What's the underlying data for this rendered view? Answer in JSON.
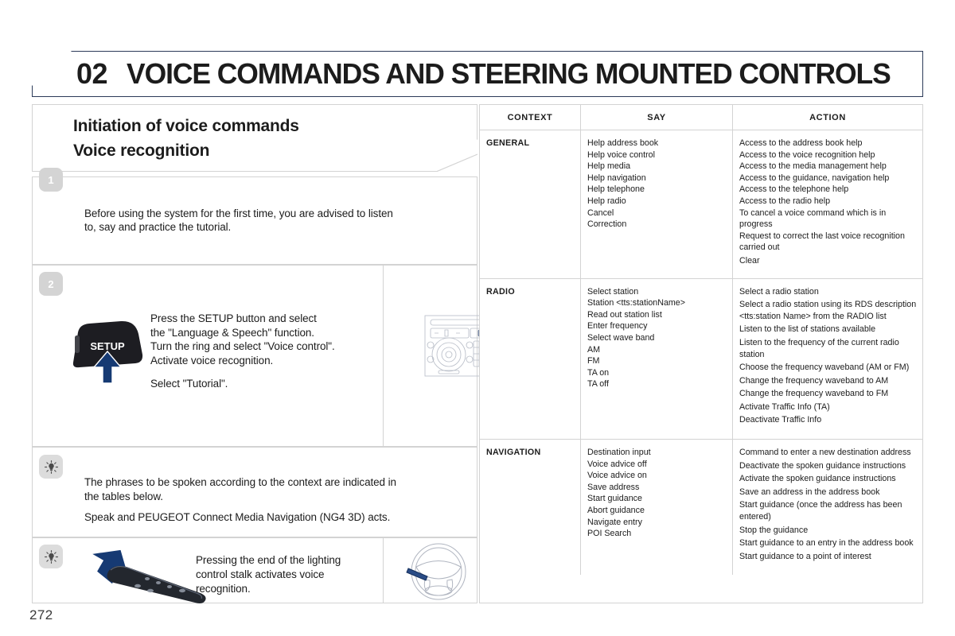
{
  "header": {
    "chapter_number": "02",
    "chapter_title": "VOICE COMMANDS AND STEERING MOUNTED CONTROLS"
  },
  "section_head": {
    "line1": "Initiation of voice commands",
    "line2": "Voice recognition",
    "icon": "speaking-head-icon"
  },
  "steps": [
    {
      "badge": "1",
      "badge_kind": "number",
      "text_lines": [
        "Before using the system for the first time, you are advised to listen",
        "to, say and practice the tutorial."
      ]
    },
    {
      "badge": "2",
      "badge_kind": "number",
      "button_label": "SETUP",
      "text_lines": [
        "Press the SETUP button and select",
        "the \"Language & Speech\" function.",
        "Turn the ring and select \"Voice control\".",
        "Activate voice recognition."
      ],
      "text_extra": "Select \"Tutorial\".",
      "illustration": "radio-head-unit-illustration"
    },
    {
      "badge": "bulb",
      "badge_kind": "bulb",
      "text_lines": [
        "The phrases to be spoken according to the context are indicated in",
        "the tables below."
      ],
      "text_extra": "Speak and PEUGEOT Connect Media Navigation (NG4 3D) acts."
    },
    {
      "badge": "bulb",
      "badge_kind": "bulb",
      "text_lines": [
        "Pressing the end of the lighting",
        "control stalk activates voice",
        "recognition."
      ],
      "illustration": "steering-wheel-illustration",
      "illustration_left": "lighting-control-stalk-illustration"
    }
  ],
  "table": {
    "columns": [
      "CONTEXT",
      "SAY",
      "ACTION"
    ],
    "rows": [
      {
        "context": "GENERAL",
        "say": [
          "Help address book",
          "Help voice control",
          "Help media",
          "Help navigation",
          "Help telephone",
          "Help radio",
          "Cancel",
          "Correction"
        ],
        "action": [
          "Access to the address book help",
          "Access to the voice recognition help",
          "Access to the media management help",
          "Access to the guidance, navigation help",
          "Access to the telephone help",
          "Access to the radio help",
          "To cancel a voice command which is in progress",
          "Request to correct the last voice recognition carried out",
          "Clear"
        ]
      },
      {
        "context": "RADIO",
        "say": [
          "Select station",
          "Station <tts:stationName>",
          "Read out station list",
          "Enter frequency",
          "Select wave band",
          "AM",
          "FM",
          "TA on",
          "TA off"
        ],
        "action": [
          "Select a radio station",
          "Select a radio station using its RDS description <tts:station Name> from the RADIO list",
          "Listen to the list of stations available",
          "Listen to the frequency of the current radio station",
          "Choose the frequency waveband (AM or FM)",
          "Change the frequency waveband to AM",
          "Change the frequency waveband to FM",
          "Activate Traffic Info (TA)",
          "Deactivate Traffic Info"
        ]
      },
      {
        "context": "NAVIGATION",
        "say": [
          "Destination input",
          "Voice advice off",
          "Voice advice on",
          "Save address",
          "Start guidance",
          "Abort guidance",
          "Navigate entry",
          "POI Search"
        ],
        "action": [
          "Command to enter a new destination address",
          "Deactivate the spoken guidance instructions",
          "Activate the spoken guidance instructions",
          "Save an address in the address book",
          "Start guidance (once the address has been entered)",
          "Stop the guidance",
          "Start guidance to an entry in the address book",
          "Start guidance to a point of interest"
        ]
      }
    ]
  },
  "footer": {
    "page_number": "272"
  },
  "colors": {
    "border_dark": "#2b3a58",
    "border_light": "#d3d3d3",
    "arrow_blue": "#1b3a6b",
    "badge_grey": "#d4d4d4"
  }
}
